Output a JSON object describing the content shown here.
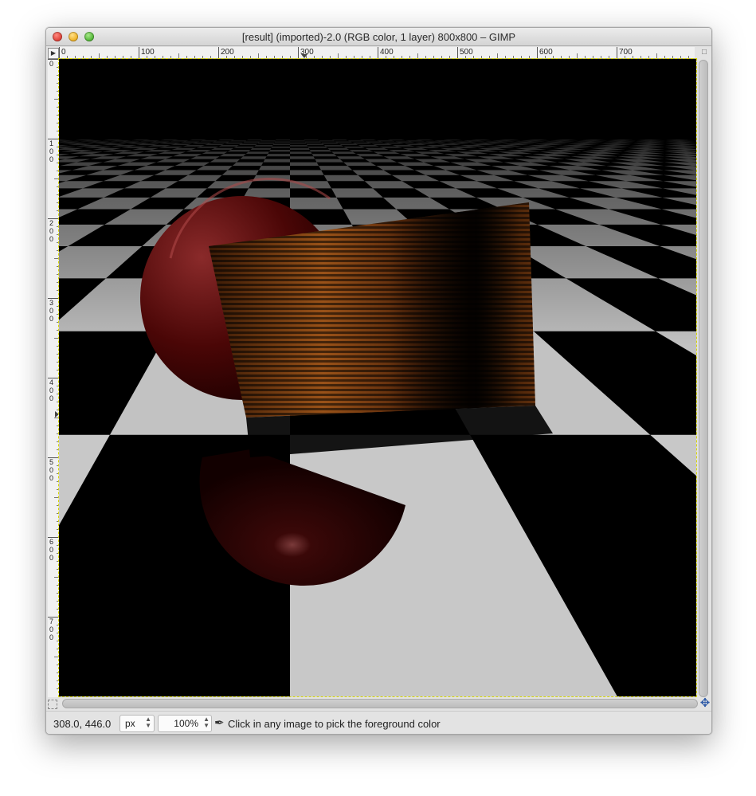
{
  "window": {
    "title": "[result] (imported)-2.0 (RGB color, 1 layer) 800x800 – GIMP"
  },
  "rulers": {
    "horizontal_labels": [
      "0",
      "100",
      "200",
      "300",
      "400",
      "500",
      "600",
      "700"
    ],
    "vertical_labels": [
      "0",
      "100",
      "200",
      "300",
      "400",
      "500",
      "600",
      "700"
    ]
  },
  "canvas": {
    "image_description": "rendered 3D scene: checkerboard floor, dark red glossy sphere and its reflection, wooden textured box"
  },
  "status": {
    "coordinates": "308.0, 446.0",
    "unit": "px",
    "zoom": "100%",
    "message": "Click in any image to pick the foreground color"
  },
  "icons": {
    "close": "close-button",
    "minimize": "minimize-button",
    "maximize": "zoom-button",
    "navigate": "navigate-icon",
    "quick_mask": "quick-mask-icon",
    "color_picker": "color-picker-icon"
  },
  "colors": {
    "checker_light": "#9a9a9a",
    "sphere": "#5a0a0a",
    "wood": "#8a4a1a",
    "marching_ants": "#d6d600"
  }
}
